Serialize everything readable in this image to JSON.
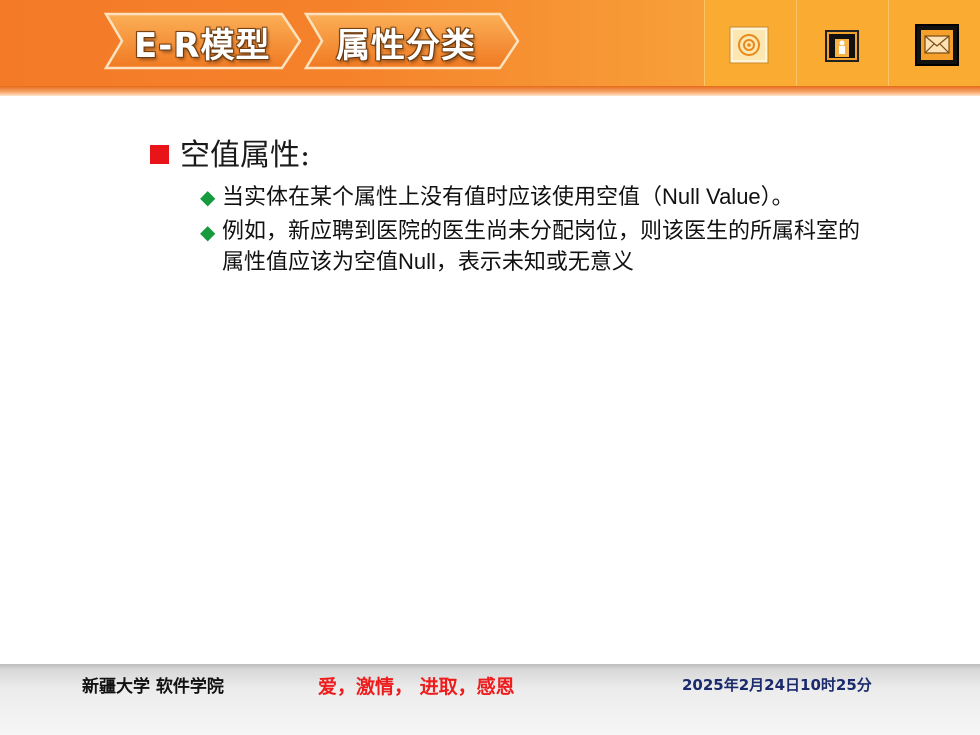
{
  "header": {
    "breadcrumb": [
      "E-R模型",
      "属性分类"
    ],
    "icons": [
      "target-icon",
      "exit-door-icon",
      "mail-icon"
    ]
  },
  "content": {
    "heading": "空值属性:",
    "items": [
      {
        "text_pre": "当实体在某个属性上没有值时应该使用空值（",
        "text_latin": "Null Value",
        "text_post": "）。"
      },
      {
        "text_pre": "例如，新应聘到医院的医生尚未分配岗位，则该医生的所属科室的属性值应该为空值",
        "text_latin": "Null",
        "text_post": "，表示未知或无意义"
      }
    ]
  },
  "footer": {
    "school": "新疆大学 软件学院",
    "motto": "爱，激情， 进取，感恩",
    "date": "2025年2月24日10时25分"
  },
  "colors": {
    "header_orange": "#f47a28",
    "icon_bar": "#f9ab32",
    "bullet_red": "#e8141a",
    "diamond_green": "#179a3e",
    "motto_red": "#ee1c1c",
    "date_blue": "#1b2a6b"
  }
}
